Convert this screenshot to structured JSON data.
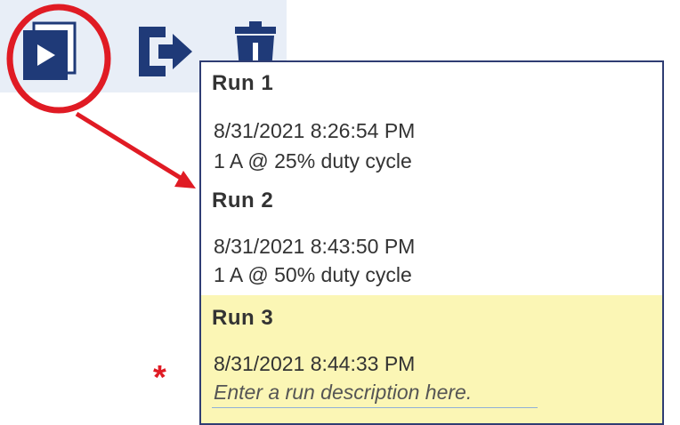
{
  "toolbar": {
    "icons": [
      "play-run-icon",
      "export-icon",
      "delete-icon"
    ]
  },
  "runs": [
    {
      "title": "Run  1",
      "date": "8/31/2021 8:26:54 PM",
      "description": "1 A @ 25% duty cycle"
    },
    {
      "title": "Run  2",
      "date": "8/31/2021 8:43:50 PM",
      "description": "1 A @ 50% duty cycle"
    },
    {
      "title": "Run  3",
      "date": "8/31/2021 8:44:33 PM",
      "description_placeholder": "Enter a run description here."
    }
  ],
  "required_marker": "*",
  "colors": {
    "navy": "#1f3a78",
    "annotation_red": "#e01b24",
    "selected_bg": "#fbf6b5",
    "toolbar_bg": "#e8eef7"
  }
}
